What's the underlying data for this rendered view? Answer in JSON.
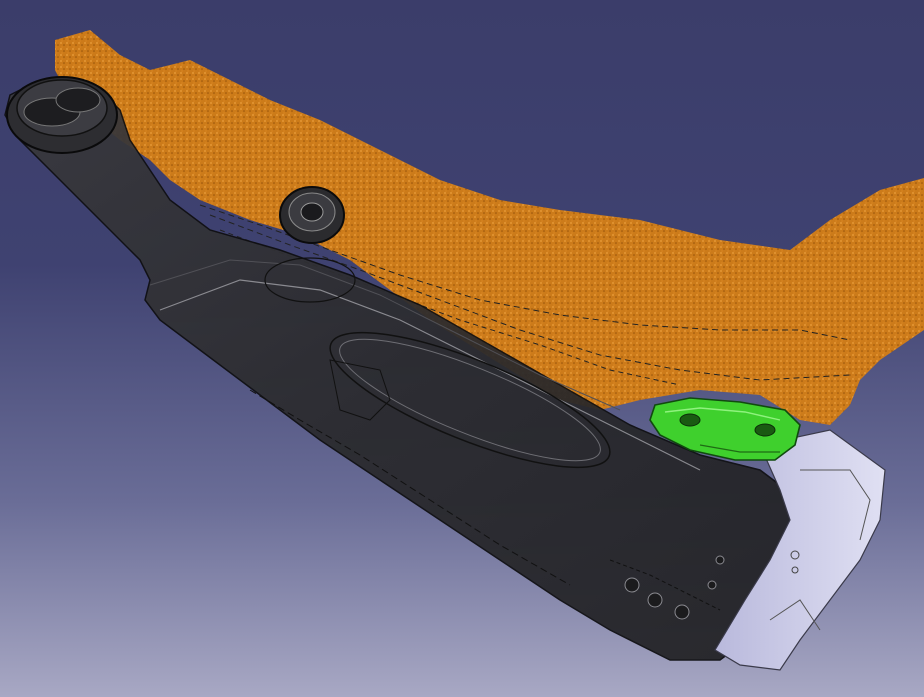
{
  "viewport": {
    "background_top": "#3b3d6a",
    "background_bottom": "#a8a8c4"
  },
  "scene": {
    "parts": [
      {
        "id": "body",
        "icon": "translucent-housing-icon",
        "color": "#2b2b2e"
      },
      {
        "id": "volume",
        "icon": "orange-volume-icon",
        "color": "#d27d16"
      },
      {
        "id": "block",
        "icon": "gray-block-icon",
        "color": "#c6c6e6"
      },
      {
        "id": "clip",
        "icon": "green-clip-icon",
        "color": "#3fd02d"
      }
    ]
  }
}
